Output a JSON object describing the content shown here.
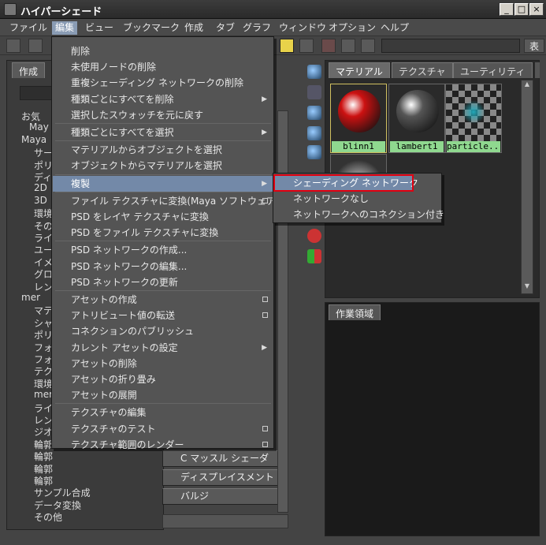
{
  "window": {
    "title": "ハイパーシェード"
  },
  "menubar": [
    "ファイル",
    "編集",
    "ビュー",
    "ブックマーク",
    "作成",
    "タブ",
    "グラフ",
    "ウィンドウ",
    "オプション",
    "ヘルプ"
  ],
  "toolbar": {
    "right_label": "表"
  },
  "left_panel": {
    "tab": "作成",
    "tree": [
      "お気",
      "May",
      "Maya",
      "サー",
      "ポリ",
      "ディ",
      "2D",
      "3D",
      "環境",
      "その",
      "ライ",
      "ユー",
      "イメ",
      "グロ",
      "レン",
      "mer",
      "マテ",
      "シャ",
      "ポリ",
      "フォ",
      "フォ",
      "テク",
      "環境",
      "mer",
      "ライ",
      "レン",
      "ジオ",
      "輪郭",
      "輪郭",
      "輪郭",
      "輪郭",
      "サンプル合成",
      "データ変換",
      "その他"
    ]
  },
  "edit_menu": {
    "items": [
      {
        "label": "削除"
      },
      {
        "label": "未使用ノードの削除"
      },
      {
        "label": "重複シェーディング ネットワークの削除"
      },
      {
        "label": "種類ごとにすべてを削除",
        "submenu": true
      },
      {
        "label": "選択したスウォッチを元に戻す"
      },
      {
        "sep": true
      },
      {
        "label": "種類ごとにすべてを選択",
        "submenu": true
      },
      {
        "sep": true
      },
      {
        "label": "マテリアルからオブジェクトを選択"
      },
      {
        "label": "オブジェクトからマテリアルを選択"
      },
      {
        "sep": true
      },
      {
        "label": "複製",
        "submenu": true,
        "highlight": true
      },
      {
        "sep": true
      },
      {
        "label": "ファイル テクスチャに変換(Maya ソフトウェア)",
        "option": true
      },
      {
        "label": "PSD をレイヤ テクスチャに変換"
      },
      {
        "label": "PSD をファイル テクスチャに変換"
      },
      {
        "sep": true
      },
      {
        "label": "PSD ネットワークの作成..."
      },
      {
        "label": "PSD ネットワークの編集..."
      },
      {
        "label": "PSD ネットワークの更新"
      },
      {
        "sep": true
      },
      {
        "label": "アセットの作成",
        "option": true
      },
      {
        "label": "アトリビュート値の転送",
        "option": true
      },
      {
        "label": "コネクションのパブリッシュ"
      },
      {
        "label": "カレント アセットの設定",
        "submenu": true
      },
      {
        "label": "アセットの削除"
      },
      {
        "label": "アセットの折り畳み"
      },
      {
        "label": "アセットの展開"
      },
      {
        "sep": true
      },
      {
        "label": "テクスチャの編集"
      },
      {
        "label": "テクスチャのテスト",
        "option": true
      },
      {
        "label": "テクスチャ範囲のレンダー",
        "option": true
      }
    ]
  },
  "submenu": {
    "items": [
      {
        "label": "シェーディング ネットワーク",
        "highlight": true
      },
      {
        "label": "ネットワークなし"
      },
      {
        "label": "ネットワークへのコネクション付き"
      }
    ]
  },
  "right_tabs": [
    "マテリアル",
    "テクスチャ",
    "ユーティリティ"
  ],
  "swatches": [
    {
      "label": "blinn1",
      "color": "#cc1111"
    },
    {
      "label": "lambert1",
      "color": "#555555"
    },
    {
      "label": "particle...",
      "color": "#22aabb"
    }
  ],
  "work_area": {
    "tab": "作業領域"
  },
  "node_buttons": [
    "C マッスル シェーダ",
    "ディスプレイスメント",
    "バルジ"
  ],
  "colors": {
    "accent": "#7389a8",
    "highlight_box": "#e00010",
    "swatch_label": "#8fd88f"
  }
}
